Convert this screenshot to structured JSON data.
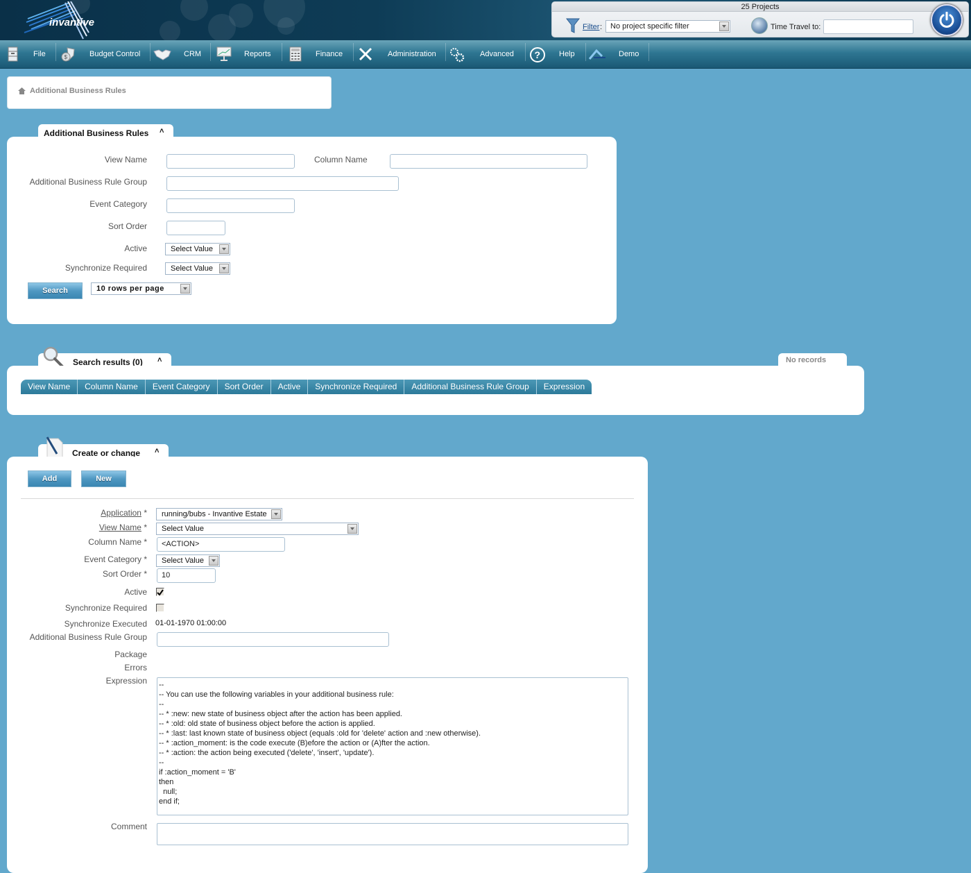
{
  "header": {
    "logo_text": "invantive",
    "projects_count": "25 Projects",
    "filter_link": "Filter",
    "filter_colon": ":",
    "filter_value": "No project specific filter",
    "time_travel_label": "Time Travel to:",
    "time_travel_value": ""
  },
  "nav": {
    "items": [
      {
        "label": "File",
        "icon": "file-cabinet-icon"
      },
      {
        "label": "Budget Control",
        "icon": "money-shield-icon"
      },
      {
        "label": "CRM",
        "icon": "handshake-icon"
      },
      {
        "label": "Reports",
        "icon": "presentation-chart-icon"
      },
      {
        "label": "Finance",
        "icon": "calculator-icon"
      },
      {
        "label": "Administration",
        "icon": "tools-icon"
      },
      {
        "label": "Advanced",
        "icon": "gears-icon"
      },
      {
        "label": "Help",
        "icon": "help-icon"
      },
      {
        "label": "Demo",
        "icon": "demo-logo-icon"
      }
    ]
  },
  "breadcrumb": {
    "title": "Additional Business Rules"
  },
  "search_panel": {
    "tab_label": "Additional Business Rules",
    "collapse_glyph": "≈",
    "fields": {
      "view_name_label": "View Name",
      "column_name_label": "Column Name",
      "group_label": "Additional Business Rule Group",
      "event_category_label": "Event Category",
      "sort_order_label": "Sort Order",
      "active_label": "Active",
      "active_value": "Select Value",
      "sync_required_label": "Synchronize Required",
      "sync_required_value": "Select Value"
    },
    "search_button": "Search",
    "rows_per_page": "10 rows per page"
  },
  "results_panel": {
    "tab_label": "Search results (0)",
    "collapse_glyph": "≈",
    "records_badge": "No records",
    "columns": [
      "View Name",
      "Column Name",
      "Event Category",
      "Sort Order",
      "Active",
      "Synchronize Required",
      "Additional Business Rule Group",
      "Expression"
    ]
  },
  "edit_panel": {
    "tab_label": "Create or change",
    "collapse_glyph": "≈",
    "add_button": "Add",
    "new_button": "New",
    "application_label": "Application",
    "application_value": "running/bubs - Invantive Estate",
    "view_name_label": "View Name",
    "view_name_value": "Select Value",
    "column_name_label": "Column Name *",
    "column_name_value": "<ACTION>",
    "event_category_label": "Event Category *",
    "event_category_value": "Select Value",
    "sort_order_label": "Sort Order *",
    "sort_order_value": "10",
    "required_mark": " *",
    "active_label": "Active",
    "active_checked": true,
    "sync_required_label": "Synchronize Required",
    "sync_required_checked": false,
    "sync_executed_label": "Synchronize Executed",
    "sync_executed_value": "01-01-1970 01:00:00",
    "group_label": "Additional Business Rule Group",
    "group_value": "",
    "package_label": "Package",
    "errors_label": "Errors",
    "expression_label": "Expression",
    "expression_value": "--\n-- You can use the following variables in your additional business rule:\n--\n-- * :new: new state of business object after the action has been applied.\n-- * :old: old state of business object before the action is applied.\n-- * :last: last known state of business object (equals :old for 'delete' action and :new otherwise).\n-- * :action_moment: is the code execute (B)efore the action or (A)fter the action.\n-- * :action: the action being executed ('delete', 'insert', 'update').\n--\nif :action_moment = 'B'\nthen\n  null;\nend if;",
    "comment_label": "Comment",
    "comment_value": ""
  }
}
